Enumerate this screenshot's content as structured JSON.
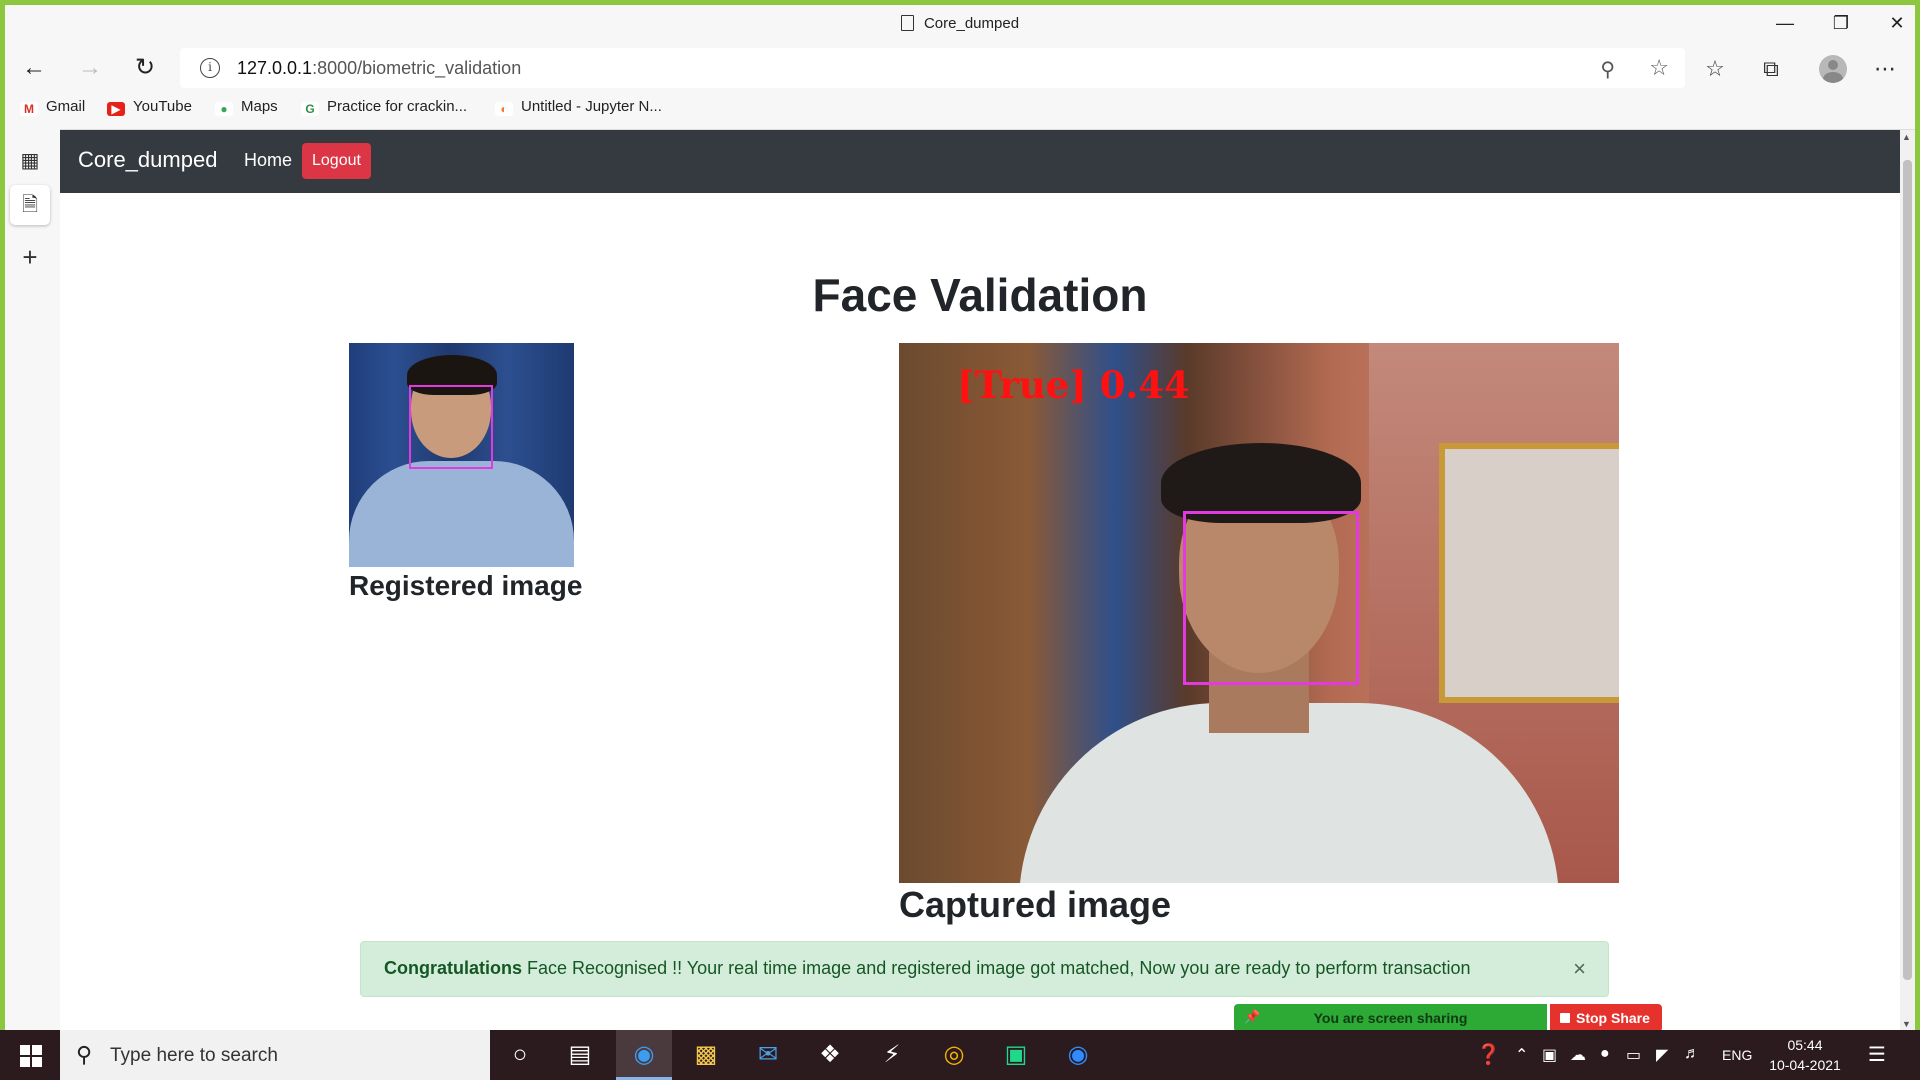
{
  "window": {
    "title": "Core_dumped"
  },
  "address": {
    "url_host": "127.0.0.1",
    "url_path": ":8000/biometric_validation"
  },
  "bookmarks": [
    {
      "label": "Gmail"
    },
    {
      "label": "YouTube"
    },
    {
      "label": "Maps"
    },
    {
      "label": "Practice for crackin..."
    },
    {
      "label": "Untitled - Jupyter N..."
    }
  ],
  "nav": {
    "brand": "Core_dumped",
    "home": "Home",
    "logout": "Logout"
  },
  "page": {
    "heading": "Face Validation",
    "registered_caption": "Registered image",
    "captured_caption": "Captured image",
    "overlay_text": "[True] 0.44"
  },
  "alert": {
    "strong": "Congratulations",
    "message": " Face Recognised !! Your real time image and registered image got matched, Now you are ready to perform transaction",
    "close": "×"
  },
  "share": {
    "status": "You are screen sharing",
    "stop": "Stop Share"
  },
  "taskbar": {
    "search_placeholder": "Type here to search",
    "lang": "ENG",
    "time": "05:44",
    "date": "10-04-2021"
  }
}
